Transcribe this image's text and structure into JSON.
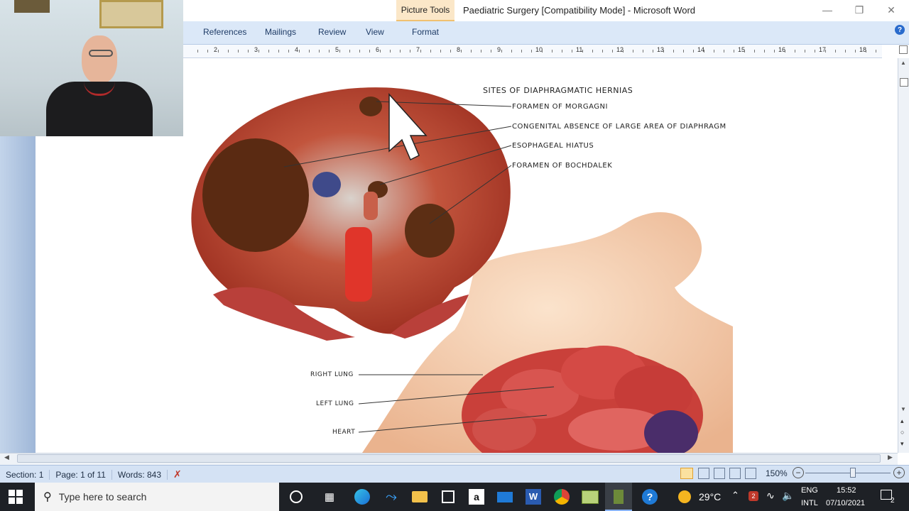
{
  "titlebar": {
    "contextual_tab": "Picture Tools",
    "window_title": "Paediatric Surgery [Compatibility Mode] - Microsoft Word"
  },
  "ribbon": {
    "tabs": [
      "References",
      "Mailings",
      "Review",
      "View",
      "Format"
    ]
  },
  "ruler": {
    "numbers": [
      "2",
      "3",
      "4",
      "5",
      "6",
      "7",
      "8",
      "9",
      "10",
      "11",
      "12",
      "13",
      "14",
      "15",
      "16",
      "17",
      "18"
    ]
  },
  "document": {
    "diagram_title": "SITES OF DIAPHRAGMATIC HERNIAS",
    "labels": [
      "FORAMEN OF MORGAGNI",
      "CONGENITAL ABSENCE OF LARGE AREA OF DIAPHRAGM",
      "ESOPHAGEAL HIATUS",
      "FORAMEN OF BOCHDALEK"
    ],
    "lower_labels": [
      "RIGHT LUNG",
      "LEFT LUNG",
      "HEART"
    ]
  },
  "statusbar": {
    "section": "Section: 1",
    "page": "Page: 1 of 11",
    "words": "Words: 843",
    "zoom": "150%"
  },
  "taskbar": {
    "search_placeholder": "Type here to search",
    "weather": "29°C",
    "lang_top": "ENG",
    "lang_bottom": "INTL",
    "time": "15:52",
    "date": "07/10/2021",
    "notifications": "2",
    "notif_badge": "2"
  }
}
